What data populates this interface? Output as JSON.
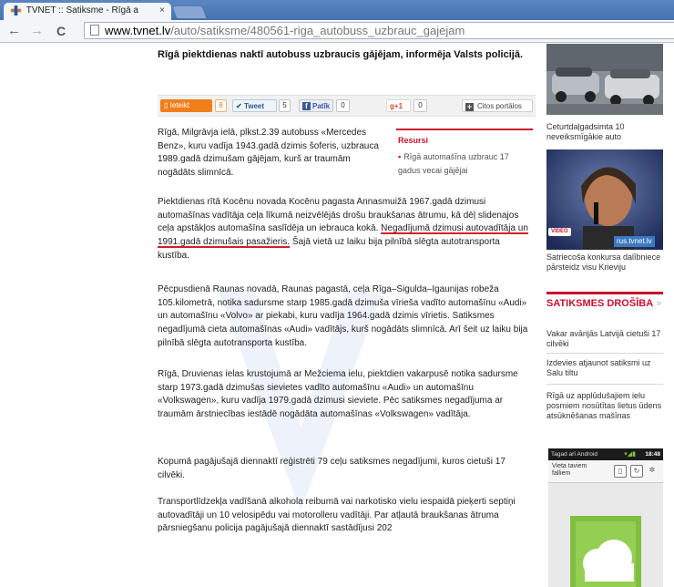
{
  "browser": {
    "tab_title": "TVNET :: Satiksme - Rīgā a",
    "tab_close": "×",
    "url_host": "www.tvnet.lv",
    "url_path": "/auto/satiksme/480561-riga_autobuss_uzbrauc_gajejam",
    "nav": {
      "back": "←",
      "forward": "→",
      "reload": "C"
    }
  },
  "article": {
    "headline": "Rīgā piektdienas naktī autobuss uzbraucis gājējam, informēja Valsts policijā.",
    "share": {
      "ieteikt": "Ieteikt",
      "ieteikt_count": "8",
      "tweet": "Tweet",
      "tweet_count": "5",
      "patik": "Patīk",
      "patik_count": "0",
      "gplus": "+1",
      "gplus_count": "0",
      "citos": "Citos portālos"
    },
    "paragraphs": {
      "p1": "Rīgā, Milgrāvja ielā, plkst.2.39 autobuss «Mercedes Benz», kuru vadīja 1943.gadā dzimis šoferis, uzbrauca 1989.gadā dzimušam gājējam, kurš ar traumām nogādāts slimnīcā.",
      "p2_before": "Piektdienas rītā Kocēnu novada Kocēnu pagasta Annasmuižā 1967.gadā dzimusi automašīnas vadītāja ceļa līkumā neizvēlējās drošu braukšanas ātrumu, kā dēļ slidenajos ceļa apstākļos automašīna saslīdēja un iebrauca kokā. ",
      "p2_underlined": "Negadījumā dzimusi autovadītāja un 1991.gadā dzimušais pasažieris.",
      "p2_after": " Šajā vietā uz laiku bija pilnībā slēgta autotransporta kustība.",
      "p3": "Pēcpusdienā Raunas novadā, Raunas pagastā, ceļa Rīga–Sigulda–Igaunijas robeža 105.kilometrā, notika sadursme starp 1985.gadā dzimuša vīrieša vadīto automašīnu «Audi» un automašīnu «Volvo» ar piekabi, kuru vadīja 1964.gadā dzimis vīrietis. Satiksmes negadījumā cieta automašīnas «Audi» vadītājs, kurš nogādāts slimnīcā. Arī šeit uz laiku bija pilnībā slēgta autotransporta kustība.",
      "p4": "Rīgā, Druvienas ielas krustojumā ar Mežciema ielu, piektdien vakarpusē notika sadursme starp 1973.gadā dzimušas sievietes vadīto automašīnu «Audi» un automašīnu «Volkswagen», kuru vadīja 1979.gadā dzimusi sieviete. Pēc satiksmes negadījuma ar traumām ārstniecības iestādē nogādāta automašīnas «Volkswagen» vadītāja.",
      "p5": "Kopumā pagājušajā diennaktī reģistrēti 79 ceļu satiksmes negadījumi, kuros cietuši 17 cilvēki.",
      "p6": "Transportlīdzekļa vadīšanā alkohola reibumā vai narkotisko vielu iespaidā pieķerti septiņi autovadītāji un 10 velosipēdu vai motorolleru vadītāji. Par atļautā braukšanas ātruma pārsniegšanu policija pagājušajā diennaktī sastādījusi 202"
    },
    "resursi": {
      "title": "Resursi",
      "item": "Rīgā automašīna uzbrauc 17 gadus vecai gājējai"
    }
  },
  "sidebar": {
    "cap1": "Ceturtdaļgadsimta 10 neveiksmīgākie auto",
    "video_badge": "VIDEO",
    "rus_badge": "rus.tvnet.lv",
    "cap2": "Satriecoša konkursa dalībniece pārsteidz visu Krieviju",
    "section_title": "SATIKSMES DROŠĪBA",
    "section_more": " »",
    "links": [
      "Vakar avārijās Latvijā cietuši 17 cilvēki",
      "Izdevies atjaunot satiksmi uz Salu tiltu",
      "Rīgā uz applūdušajiem ielu posmiem nosūtītas lietus ūdens atsūknēšanas mašīnas"
    ],
    "phone": {
      "status_text": "Tagad arī Android",
      "clock": "18:48",
      "location": "Vieta taviem falliem"
    }
  },
  "colors": {
    "accent_red": "#c8102e",
    "tab_bar": "#4472b3",
    "ieteikt_orange": "#f07f1a"
  },
  "icons": {
    "favicon": "tvnet-favicon-icon",
    "page": "page-icon",
    "gplus": "g-plus-icon",
    "citos": "plus-square-icon"
  }
}
